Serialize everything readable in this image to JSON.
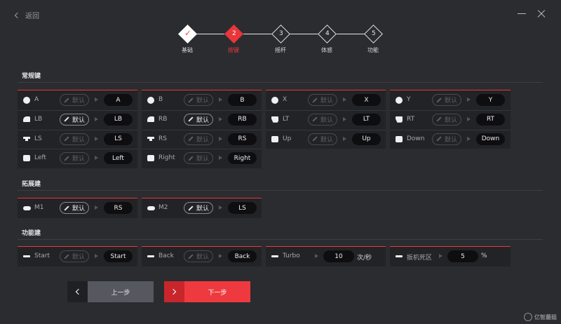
{
  "header": {
    "back_label": "返回"
  },
  "steps": [
    {
      "number": "✓",
      "label": "基础",
      "state": "done"
    },
    {
      "number": "2",
      "label": "按键",
      "state": "active"
    },
    {
      "number": "3",
      "label": "摇杆",
      "state": "pending"
    },
    {
      "number": "4",
      "label": "体感",
      "state": "pending"
    },
    {
      "number": "5",
      "label": "功能",
      "state": "pending"
    }
  ],
  "sections": {
    "regular": "常规键",
    "extended": "拓展建",
    "function": "功能建"
  },
  "default_label": "默认",
  "regular_keys": [
    {
      "key": "A",
      "value": "A",
      "icon": "circle",
      "default_on": false
    },
    {
      "key": "B",
      "value": "B",
      "icon": "circle",
      "default_on": false
    },
    {
      "key": "X",
      "value": "X",
      "icon": "circle",
      "default_on": false
    },
    {
      "key": "Y",
      "value": "Y",
      "icon": "circle",
      "default_on": false
    },
    {
      "key": "LB",
      "value": "LB",
      "icon": "bumper",
      "default_on": true
    },
    {
      "key": "RB",
      "value": "RB",
      "icon": "bumper",
      "default_on": true
    },
    {
      "key": "LT",
      "value": "LT",
      "icon": "trigger",
      "default_on": false
    },
    {
      "key": "RT",
      "value": "RT",
      "icon": "trigger",
      "default_on": false
    },
    {
      "key": "LS",
      "value": "LS",
      "icon": "stick",
      "default_on": false
    },
    {
      "key": "RS",
      "value": "RS",
      "icon": "stick",
      "default_on": false
    },
    {
      "key": "Up",
      "value": "Up",
      "icon": "square",
      "default_on": false
    },
    {
      "key": "Down",
      "value": "Down",
      "icon": "square",
      "default_on": false
    },
    {
      "key": "Left",
      "value": "Left",
      "icon": "square",
      "default_on": false
    },
    {
      "key": "Right",
      "value": "Right",
      "icon": "square",
      "default_on": false
    }
  ],
  "extended_keys": [
    {
      "key": "M1",
      "value": "RS",
      "icon": "pill",
      "default_on": true
    },
    {
      "key": "M2",
      "value": "LS",
      "icon": "pill",
      "default_on": true
    }
  ],
  "function_keys": {
    "start": {
      "key": "Start",
      "value": "Start"
    },
    "back": {
      "key": "Back",
      "value": "Back"
    },
    "turbo": {
      "key": "Turbo",
      "value": "10",
      "unit": "次/秒"
    },
    "deadzone": {
      "key": "扳机死区",
      "value": "5",
      "unit": "%"
    }
  },
  "buttons": {
    "prev": "上一步",
    "next": "下一步"
  },
  "colors": {
    "accent": "#e8363b",
    "background": "#2b2c30",
    "panel": "#222326"
  },
  "watermark": "亿智蘑菇"
}
